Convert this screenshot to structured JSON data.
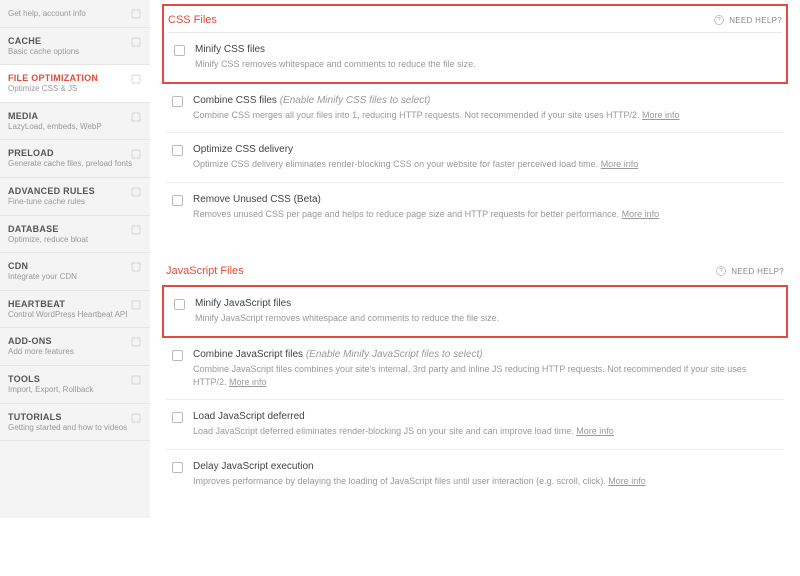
{
  "sidebar": [
    {
      "title": "",
      "sub": "Get help, account info"
    },
    {
      "title": "CACHE",
      "sub": "Basic cache options"
    },
    {
      "title": "FILE OPTIMIZATION",
      "sub": "Optimize CSS & JS",
      "active": true
    },
    {
      "title": "MEDIA",
      "sub": "LazyLoad, embeds, WebP"
    },
    {
      "title": "PRELOAD",
      "sub": "Generate cache files, preload fonts"
    },
    {
      "title": "ADVANCED RULES",
      "sub": "Fine-tune cache rules"
    },
    {
      "title": "DATABASE",
      "sub": "Optimize, reduce bloat"
    },
    {
      "title": "CDN",
      "sub": "Integrate your CDN"
    },
    {
      "title": "HEARTBEAT",
      "sub": "Control WordPress Heartbeat API"
    },
    {
      "title": "ADD-ONS",
      "sub": "Add more features"
    },
    {
      "title": "TOOLS",
      "sub": "Import, Export, Rollback"
    },
    {
      "title": "TUTORIALS",
      "sub": "Getting started and how to videos"
    }
  ],
  "need_help": "NEED HELP?",
  "more_info": "More info",
  "css": {
    "heading": "CSS Files",
    "minify": {
      "title": "Minify CSS files",
      "desc": "Minify CSS removes whitespace and comments to reduce the file size."
    },
    "combine": {
      "title": "Combine CSS files ",
      "hint": "(Enable Minify CSS files to select)",
      "desc": "Combine CSS merges all your files into 1, reducing HTTP requests. Not recommended if your site uses HTTP/2. "
    },
    "optimize": {
      "title": "Optimize CSS delivery",
      "desc": "Optimize CSS delivery eliminates render-blocking CSS on your website for faster perceived load time. "
    },
    "remove": {
      "title": "Remove Unused CSS (Beta)",
      "desc": "Removes unused CSS per page and helps to reduce page size and HTTP requests for better performance. "
    }
  },
  "js": {
    "heading": "JavaScript Files",
    "minify": {
      "title": "Minify JavaScript files",
      "desc": "Minify JavaScript removes whitespace and comments to reduce the file size."
    },
    "combine": {
      "title": "Combine JavaScript files ",
      "hint": "(Enable Minify JavaScript files to select)",
      "desc": "Combine JavaScript files combines your site's internal, 3rd party and inline JS reducing HTTP requests. Not recommended if your site uses HTTP/2. "
    },
    "deferred": {
      "title": "Load JavaScript deferred",
      "desc": "Load JavaScript deferred eliminates render-blocking JS on your site and can improve load time. "
    },
    "delay": {
      "title": "Delay JavaScript execution",
      "desc": "Improves performance by delaying the loading of JavaScript files until user interaction (e.g. scroll, click). "
    }
  }
}
